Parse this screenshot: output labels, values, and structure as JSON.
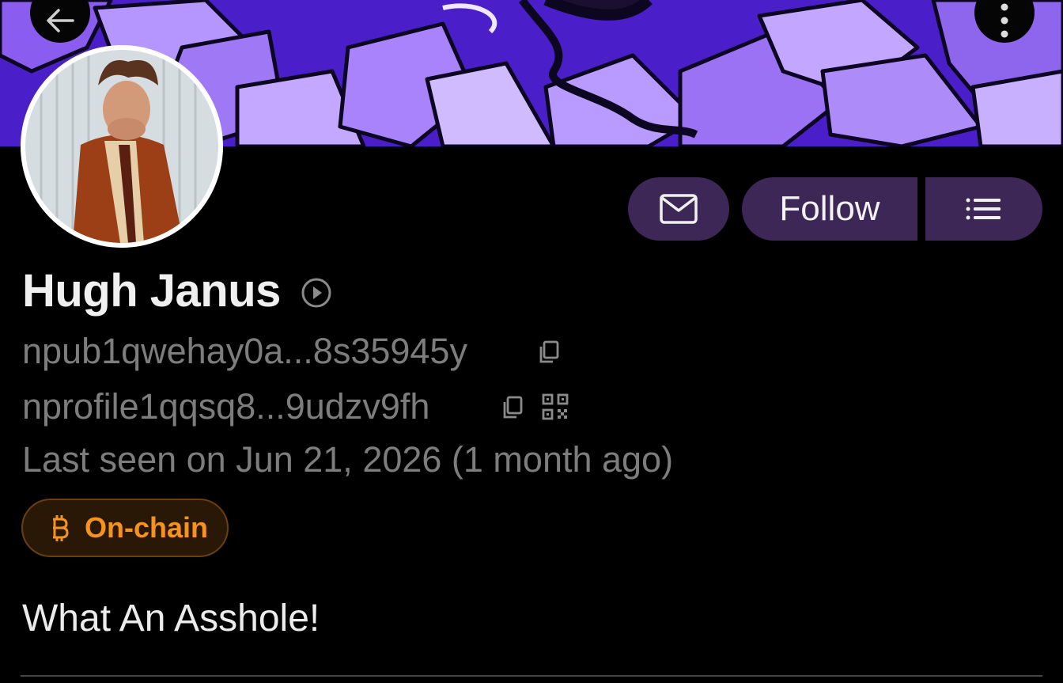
{
  "header": {
    "back_icon": "arrow-left-icon",
    "more_icon": "more-vertical-icon"
  },
  "actions": {
    "message_icon": "envelope-icon",
    "follow_label": "Follow",
    "list_icon": "list-icon"
  },
  "profile": {
    "name": "Hugh Janus",
    "name_badge_icon": "play-circle-icon",
    "npub": "npub1qwehay0a...8s35945y",
    "nprofile": "nprofile1qqsq8...9udzv9fh",
    "last_seen": "Last seen on Jun 21, 2026 (1 month ago)",
    "badge": {
      "icon": "bitcoin-icon",
      "label": "On-chain",
      "color": "#f7931a"
    },
    "about": "What An Asshole!"
  },
  "colors": {
    "background": "#000000",
    "button": "#3d2756",
    "muted_text": "#7d7d7d",
    "banner": "#4a1fc9"
  }
}
